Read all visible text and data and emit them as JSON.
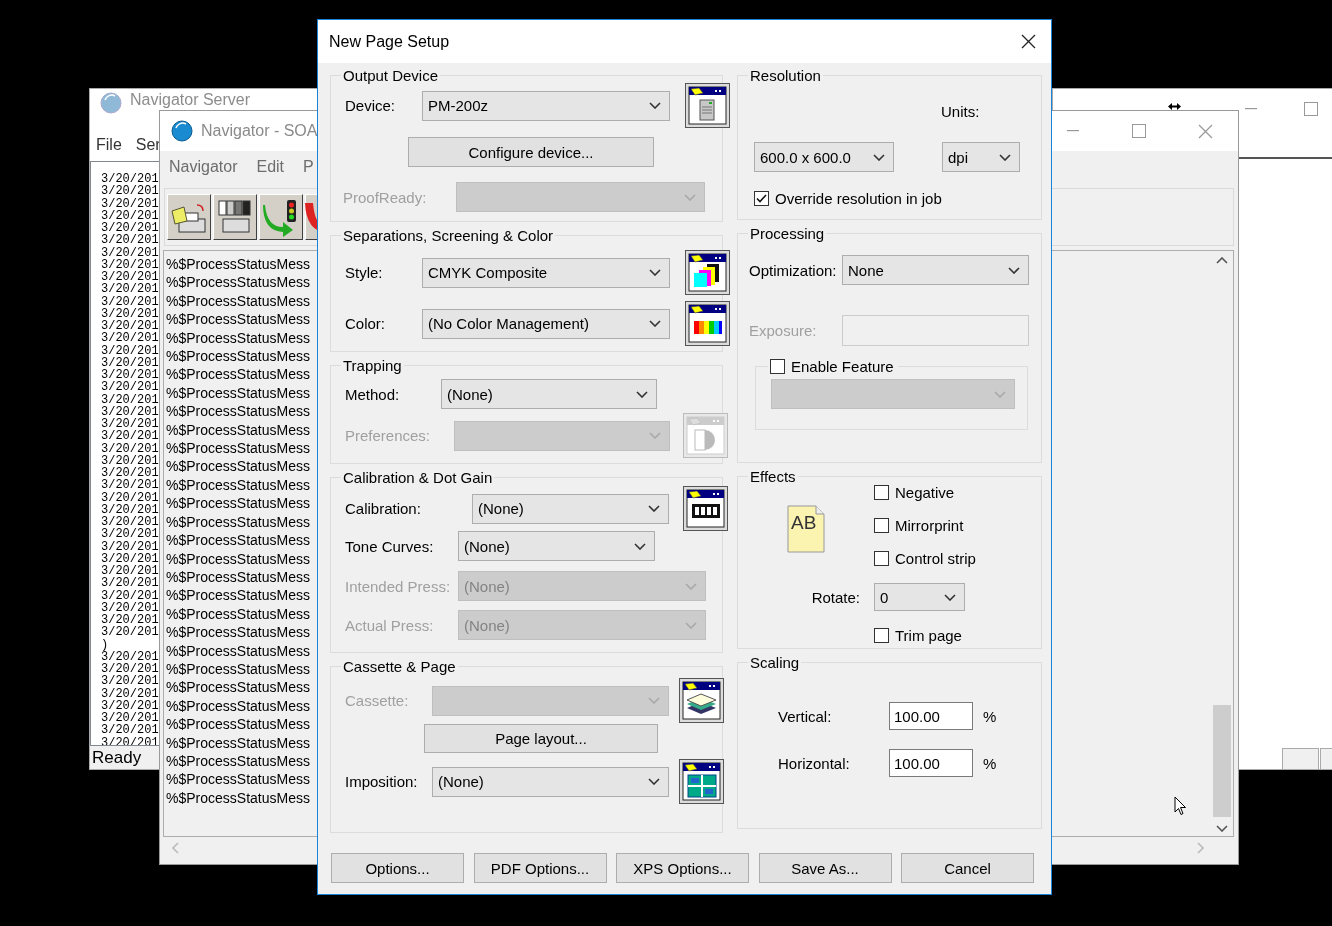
{
  "server_window": {
    "title": "Navigator Server",
    "menu": [
      "File",
      "Ser"
    ],
    "log_lines": [
      "3/20/201",
      "3/20/201",
      "3/20/201",
      "3/20/201",
      "3/20/201",
      "3/20/201",
      "3/20/201",
      "3/20/201",
      "3/20/201",
      "3/20/201",
      "3/20/201",
      "3/20/201",
      "3/20/201",
      "3/20/201",
      "3/20/201",
      "3/20/201",
      "3/20/201",
      "3/20/201",
      "3/20/201",
      "3/20/201",
      "3/20/201",
      "3/20/201",
      "3/20/201",
      "3/20/201",
      "3/20/201",
      "3/20/201",
      "3/20/201",
      "3/20/201",
      "3/20/201",
      "3/20/201",
      "3/20/201",
      "3/20/201",
      "3/20/201",
      "3/20/201",
      "3/20/201",
      "3/20/201",
      "3/20/201",
      "3/20/201",
      ")",
      "3/20/201",
      "3/20/201",
      "3/20/201",
      "3/20/201",
      "3/20/201",
      "3/20/201",
      "3/20/201",
      "3/20/201"
    ],
    "status": "Ready"
  },
  "soa_window": {
    "title": "Navigator - SOA",
    "menu": [
      "Navigator",
      "Edit",
      "P"
    ],
    "messages": [
      "%$ProcessStatusMess",
      "%$ProcessStatusMess",
      "%$ProcessStatusMess",
      "%$ProcessStatusMess",
      "%$ProcessStatusMess",
      "%$ProcessStatusMess",
      "%$ProcessStatusMess",
      "%$ProcessStatusMess",
      "%$ProcessStatusMess",
      "%$ProcessStatusMess",
      "%$ProcessStatusMess",
      "%$ProcessStatusMess",
      "%$ProcessStatusMess",
      "%$ProcessStatusMess",
      "%$ProcessStatusMess",
      "%$ProcessStatusMess",
      "%$ProcessStatusMess",
      "%$ProcessStatusMess",
      "%$ProcessStatusMess",
      "%$ProcessStatusMess",
      "%$ProcessStatusMess",
      "%$ProcessStatusMess",
      "%$ProcessStatusMess",
      "%$ProcessStatusMess",
      "%$ProcessStatusMess",
      "%$ProcessStatusMess",
      "%$ProcessStatusMess",
      "%$ProcessStatusMess",
      "%$ProcessStatusMess",
      "%$ProcessStatusMess"
    ]
  },
  "dialog": {
    "title": "New Page Setup",
    "output_device": {
      "title": "Output Device",
      "device": {
        "label": "Device:",
        "value": "PM-200z",
        "disabled": false
      },
      "configure_button": "Configure device...",
      "proofready": {
        "label": "ProofReady:",
        "disabled": true
      }
    },
    "separations": {
      "title": "Separations, Screening & Color",
      "style": {
        "label": "Style:",
        "value": "CMYK Composite",
        "disabled": false
      },
      "color": {
        "label": "Color:",
        "value": "(No Color Management)",
        "disabled": false
      }
    },
    "trapping": {
      "title": "Trapping",
      "method": {
        "label": "Method:",
        "value": "(None)",
        "disabled": false
      },
      "preferences": {
        "label": "Preferences:",
        "disabled": true
      }
    },
    "calibration": {
      "title": "Calibration & Dot Gain",
      "calibration": {
        "label": "Calibration:",
        "value": "(None)",
        "disabled": false
      },
      "tone_curves": {
        "label": "Tone Curves:",
        "value": "(None)",
        "disabled": false
      },
      "intended_press": {
        "label": "Intended Press:",
        "value": "(None)",
        "disabled": true
      },
      "actual_press": {
        "label": "Actual Press:",
        "value": "(None)",
        "disabled": true
      }
    },
    "cassette_page": {
      "title": "Cassette & Page",
      "cassette": {
        "label": "Cassette:",
        "disabled": true
      },
      "page_layout_button": "Page layout...",
      "imposition": {
        "label": "Imposition:",
        "value": "(None)",
        "disabled": false
      }
    },
    "resolution": {
      "title": "Resolution",
      "units_label": "Units:",
      "resolution": {
        "value": "600.0 x 600.0",
        "disabled": false
      },
      "units": {
        "value": "dpi",
        "disabled": false
      },
      "override": {
        "label": "Override resolution in job",
        "checked": true
      }
    },
    "processing": {
      "title": "Processing",
      "optimization": {
        "label": "Optimization:",
        "value": "None",
        "disabled": false
      },
      "exposure": {
        "label": "Exposure:",
        "disabled": true
      },
      "enable_feature": {
        "label": "Enable Feature",
        "checked": false
      },
      "feature_select": {
        "disabled": true
      }
    },
    "effects": {
      "title": "Effects",
      "preview": "AB",
      "options": [
        {
          "label": "Negative",
          "checked": false
        },
        {
          "label": "Mirrorprint",
          "checked": false
        },
        {
          "label": "Control strip",
          "checked": false
        }
      ],
      "rotate": {
        "label": "Rotate:",
        "value": "0",
        "disabled": false
      },
      "trim_page": {
        "label": "Trim page",
        "checked": false
      }
    },
    "scaling": {
      "title": "Scaling",
      "vertical": {
        "label": "Vertical:",
        "value": "100.00",
        "unit": "%"
      },
      "horizontal": {
        "label": "Horizontal:",
        "value": "100.00",
        "unit": "%"
      }
    },
    "buttons": [
      "Options...",
      "PDF Options...",
      "XPS Options...",
      "Save As...",
      "Cancel"
    ]
  }
}
